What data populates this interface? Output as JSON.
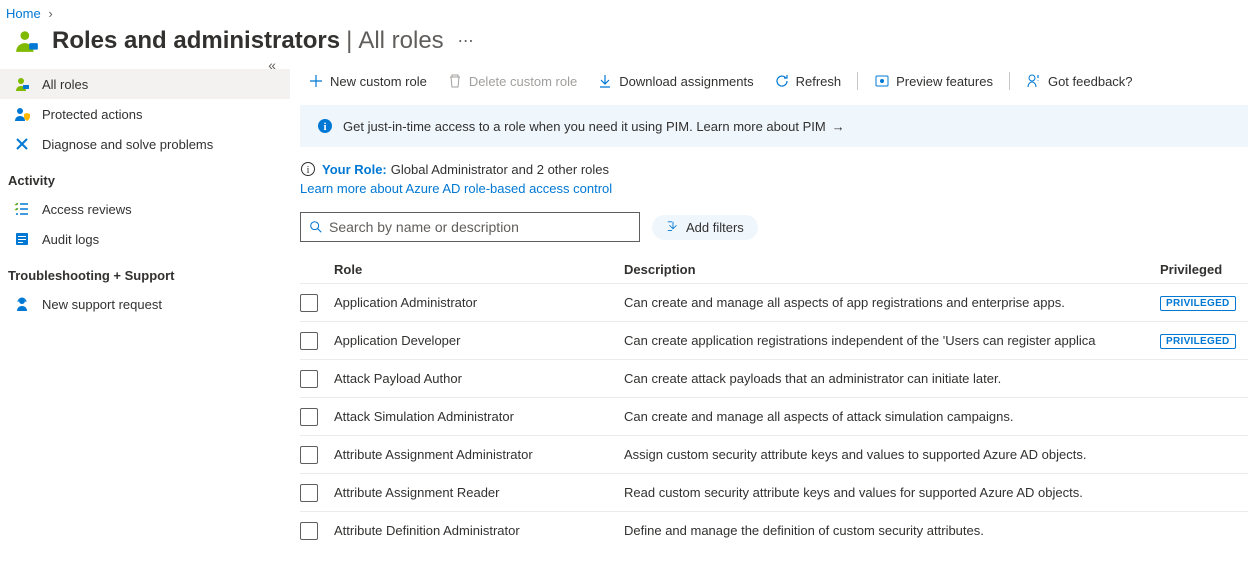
{
  "breadcrumb": {
    "home": "Home"
  },
  "page": {
    "title": "Roles and administrators",
    "subtitle": "All roles"
  },
  "sidebar": {
    "items": [
      {
        "label": "All roles"
      },
      {
        "label": "Protected actions"
      },
      {
        "label": "Diagnose and solve problems"
      }
    ],
    "sections": [
      {
        "title": "Activity",
        "items": [
          {
            "label": "Access reviews"
          },
          {
            "label": "Audit logs"
          }
        ]
      },
      {
        "title": "Troubleshooting + Support",
        "items": [
          {
            "label": "New support request"
          }
        ]
      }
    ]
  },
  "toolbar": {
    "new_role": "New custom role",
    "delete_role": "Delete custom role",
    "download": "Download assignments",
    "refresh": "Refresh",
    "preview": "Preview features",
    "feedback": "Got feedback?"
  },
  "banner": {
    "text": "Get just-in-time access to a role when you need it using PIM. Learn more about PIM"
  },
  "your_role": {
    "label": "Your Role:",
    "value": "Global Administrator and 2 other roles"
  },
  "learn_link": "Learn more about Azure AD role-based access control",
  "search": {
    "placeholder": "Search by name or description"
  },
  "filter_pill": "Add filters",
  "table": {
    "headers": {
      "role": "Role",
      "desc": "Description",
      "priv": "Privileged"
    },
    "priv_badge": "PRIVILEGED",
    "rows": [
      {
        "role": "Application Administrator",
        "desc": "Can create and manage all aspects of app registrations and enterprise apps.",
        "privileged": true
      },
      {
        "role": "Application Developer",
        "desc": "Can create application registrations independent of the 'Users can register applica",
        "privileged": true
      },
      {
        "role": "Attack Payload Author",
        "desc": "Can create attack payloads that an administrator can initiate later.",
        "privileged": false
      },
      {
        "role": "Attack Simulation Administrator",
        "desc": "Can create and manage all aspects of attack simulation campaigns.",
        "privileged": false
      },
      {
        "role": "Attribute Assignment Administrator",
        "desc": "Assign custom security attribute keys and values to supported Azure AD objects.",
        "privileged": false
      },
      {
        "role": "Attribute Assignment Reader",
        "desc": "Read custom security attribute keys and values for supported Azure AD objects.",
        "privileged": false
      },
      {
        "role": "Attribute Definition Administrator",
        "desc": "Define and manage the definition of custom security attributes.",
        "privileged": false
      }
    ]
  }
}
